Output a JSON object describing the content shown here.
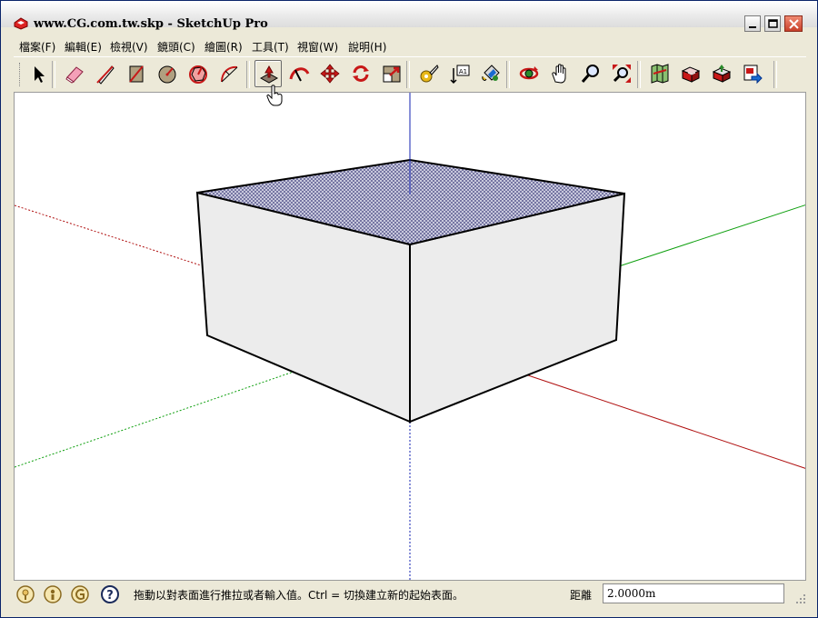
{
  "window": {
    "title": "www.CG.com.tw.skp - SketchUp Pro"
  },
  "menus": [
    "檔案(F)",
    "編輯(E)",
    "檢視(V)",
    "鏡頭(C)",
    "繪圖(R)",
    "工具(T)",
    "視窗(W)",
    "說明(H)"
  ],
  "toolbar": {
    "tools": [
      {
        "name": "select-icon",
        "active": false
      },
      {
        "name": "eraser-icon",
        "active": false
      },
      {
        "name": "pencil-line-icon",
        "active": false
      },
      {
        "name": "rectangle-icon",
        "active": false
      },
      {
        "name": "circle-icon",
        "active": false
      },
      {
        "name": "polygon-icon",
        "active": false
      },
      {
        "name": "arc-icon",
        "active": false
      },
      {
        "name": "push-pull-icon",
        "active": true
      },
      {
        "name": "follow-me-icon",
        "active": false
      },
      {
        "name": "move-icon",
        "active": false
      },
      {
        "name": "rotate-icon",
        "active": false
      },
      {
        "name": "scale-icon",
        "active": false
      },
      {
        "name": "tape-measure-icon",
        "active": false
      },
      {
        "name": "text-icon",
        "active": false
      },
      {
        "name": "paint-bucket-icon",
        "active": false
      },
      {
        "name": "orbit-icon",
        "active": false
      },
      {
        "name": "pan-icon",
        "active": false
      },
      {
        "name": "zoom-icon",
        "active": false
      },
      {
        "name": "zoom-extents-icon",
        "active": false
      },
      {
        "name": "warehouse-map-icon",
        "active": false
      },
      {
        "name": "get-models-icon",
        "active": false
      },
      {
        "name": "share-model-icon",
        "active": false
      },
      {
        "name": "export-layout-icon",
        "active": false
      }
    ],
    "text_tool_glyph": "A1"
  },
  "colors": {
    "axis_red": "#b01010",
    "axis_green": "#10a010",
    "axis_blue": "#1020b0",
    "face_front": "#ececec",
    "face_top": "#a8a8c8",
    "accent": "#c81818"
  },
  "statusbar": {
    "icons": [
      "geo-location-icon",
      "credits-icon",
      "user-account-icon",
      "help-icon"
    ],
    "help_glyph": "?",
    "message": "拖動以對表面進行推拉或者輸入值。Ctrl = 切換建立新的起始表面。",
    "measure_label": "距離",
    "measure_value": "2.0000m"
  }
}
